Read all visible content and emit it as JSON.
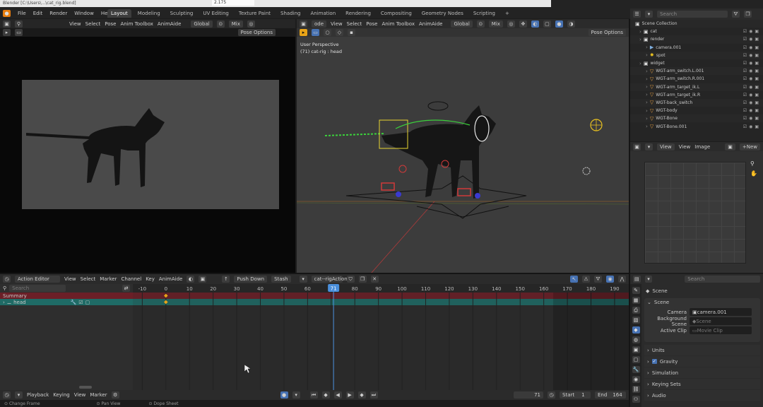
{
  "window": {
    "title_strip": "Blender [C:\\Users\\...\\cat_rig.blend]",
    "version": "2.175"
  },
  "menus": [
    "File",
    "Edit",
    "Render",
    "Window",
    "Help"
  ],
  "workspaces": [
    "Layout",
    "Modeling",
    "Sculpting",
    "UV Editing",
    "Texture Paint",
    "Shading",
    "Animation",
    "Rendering",
    "Compositing",
    "Geometry Nodes",
    "Scripting"
  ],
  "active_workspace": "Layout",
  "left_header": {
    "items": [
      "View",
      "Select",
      "Pose",
      "Anim Toolbox",
      "AnimAide"
    ],
    "orientation": "Global",
    "pivot": "Mix",
    "pose_options": "Pose Options"
  },
  "viewport": {
    "mode": "ode",
    "items": [
      "View",
      "Select",
      "Pose",
      "Anim Toolbox",
      "AnimAide"
    ],
    "orientation": "Global",
    "pivot": "Mix",
    "pose_options": "Pose Options",
    "overlay_title": "User Perspective",
    "overlay_subtitle": "(71) cat-rig : head"
  },
  "outliner": {
    "search_placeholder": "Search",
    "rows": [
      {
        "name": "Scene Collection",
        "indent": 0,
        "icon": "collection-icon"
      },
      {
        "name": "cat",
        "indent": 1,
        "icon": "collection-icon"
      },
      {
        "name": "render",
        "indent": 1,
        "icon": "collection-icon"
      },
      {
        "name": "camera.001",
        "indent": 2,
        "icon": "camera-icon"
      },
      {
        "name": "spot",
        "indent": 2,
        "icon": "light-icon"
      },
      {
        "name": "widget",
        "indent": 1,
        "icon": "collection-icon"
      },
      {
        "name": "WGT-arm_switch.L.001",
        "indent": 2,
        "icon": "mesh-icon"
      },
      {
        "name": "WGT-arm_switch.R.001",
        "indent": 2,
        "icon": "mesh-icon"
      },
      {
        "name": "WGT-arm_target_ik.L",
        "indent": 2,
        "icon": "mesh-icon"
      },
      {
        "name": "WGT-arm_target_ik.R",
        "indent": 2,
        "icon": "mesh-icon"
      },
      {
        "name": "WGT-back_switch",
        "indent": 2,
        "icon": "mesh-icon"
      },
      {
        "name": "WGT-body",
        "indent": 2,
        "icon": "mesh-icon"
      },
      {
        "name": "WGT-Bone",
        "indent": 2,
        "icon": "mesh-icon"
      },
      {
        "name": "WGT-Bone.001",
        "indent": 2,
        "icon": "mesh-icon"
      }
    ]
  },
  "image_editor": {
    "items": [
      "View",
      "View",
      "Image"
    ],
    "new_label": "New"
  },
  "properties": {
    "search_placeholder": "Search",
    "breadcrumb": "Scene",
    "panel_title": "Scene",
    "camera_label": "Camera",
    "camera_value": "camera.001",
    "background_label": "Background Scene",
    "background_value": "Scene",
    "clip_label": "Active Clip",
    "clip_value": "Movie Clip",
    "sections": [
      "Units",
      "Gravity",
      "Simulation",
      "Keying Sets",
      "Audio"
    ],
    "gravity_checked": true
  },
  "dopesheet": {
    "editor": "Action Editor",
    "items": [
      "View",
      "Select",
      "Marker",
      "Channel",
      "Key",
      "AnimAide"
    ],
    "push_down": "Push Down",
    "stash": "Stash",
    "action": "cat--rigAction",
    "search_placeholder": "Search",
    "channels": [
      "Summary",
      "head"
    ],
    "frames": [
      -10,
      0,
      10,
      20,
      30,
      40,
      50,
      60,
      70,
      80,
      90,
      100,
      110,
      120,
      130,
      140,
      150,
      160,
      170,
      180,
      190
    ],
    "current_frame": 71,
    "current_frame_label": "71"
  },
  "timeline": {
    "items": [
      "Playback",
      "Keying",
      "View",
      "Marker"
    ],
    "frame_value": "71",
    "start_label": "Start",
    "start_value": "1",
    "end_label": "End",
    "end_value": "164"
  },
  "status_bar": [
    "Change Frame",
    "Pan View",
    "Dope Sheet"
  ],
  "colors": {
    "accent": "#4772b3",
    "summary_row": "#6b1f27",
    "channel_row": "#1f6b66",
    "playhead": "#4a8fdc"
  }
}
